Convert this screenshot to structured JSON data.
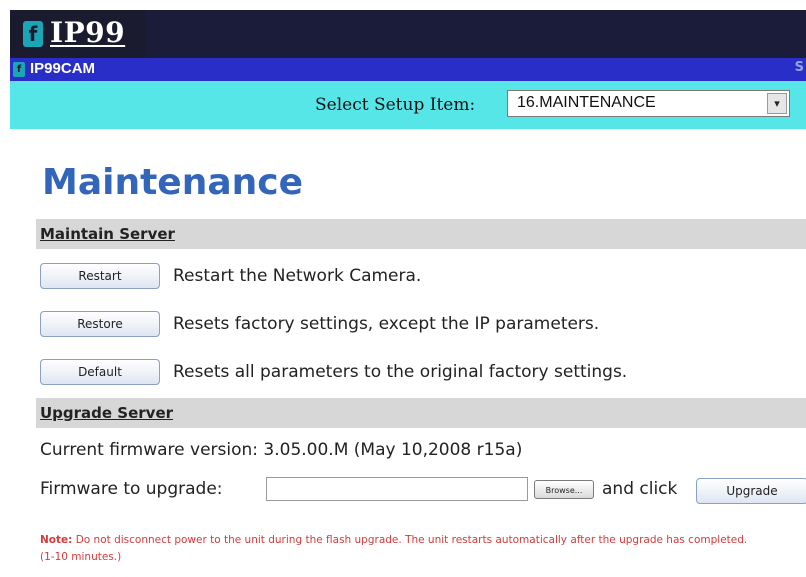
{
  "brand": {
    "logo_text": "IP99",
    "logo_mark": "f"
  },
  "window": {
    "title": "IP99CAM",
    "right_fragment": "S"
  },
  "setup": {
    "label": "Select Setup Item:",
    "selected": "16.MAINTENANCE",
    "arrow": "▾"
  },
  "page": {
    "title": "Maintenance"
  },
  "maintain_server": {
    "title": "Maintain Server",
    "restart": {
      "label": "Restart",
      "desc": "Restart the Network Camera."
    },
    "restore": {
      "label": "Restore",
      "desc": "Resets factory settings, except the IP parameters."
    },
    "default": {
      "label": "Default",
      "desc": "Resets all parameters to the original factory settings."
    }
  },
  "upgrade_server": {
    "title": "Upgrade Server",
    "firmware_version": "Current firmware version: 3.05.00.M (May 10,2008 r15a)",
    "firmware_label": "Firmware to upgrade:",
    "file_value": "",
    "browse_label": "Browse...",
    "and_click": "and click",
    "upgrade_label": "Upgrade"
  },
  "note": {
    "label": "Note:",
    "text": "Do not disconnect power to the unit during the flash upgrade. The unit restarts automatically after the upgrade has completed. (1-10 minutes.)"
  }
}
